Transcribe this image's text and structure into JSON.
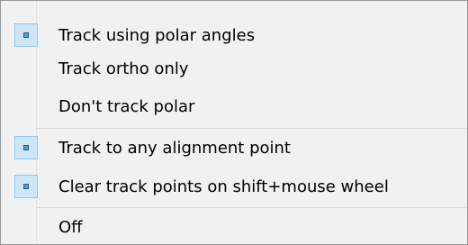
{
  "menu": {
    "items": [
      {
        "label": "Track using polar angles",
        "checked": true
      },
      {
        "label": "Track ortho only",
        "checked": false
      },
      {
        "label": "Don't track polar",
        "checked": false
      },
      {
        "label": "Track to any alignment point",
        "checked": true
      },
      {
        "label": "Clear track points on shift+mouse wheel",
        "checked": true
      },
      {
        "label": "Off",
        "checked": false
      }
    ]
  },
  "colors": {
    "background": "#f1f1f1",
    "border": "#979797",
    "check_fill": "#cde6f7",
    "check_border": "#90c8f6"
  }
}
